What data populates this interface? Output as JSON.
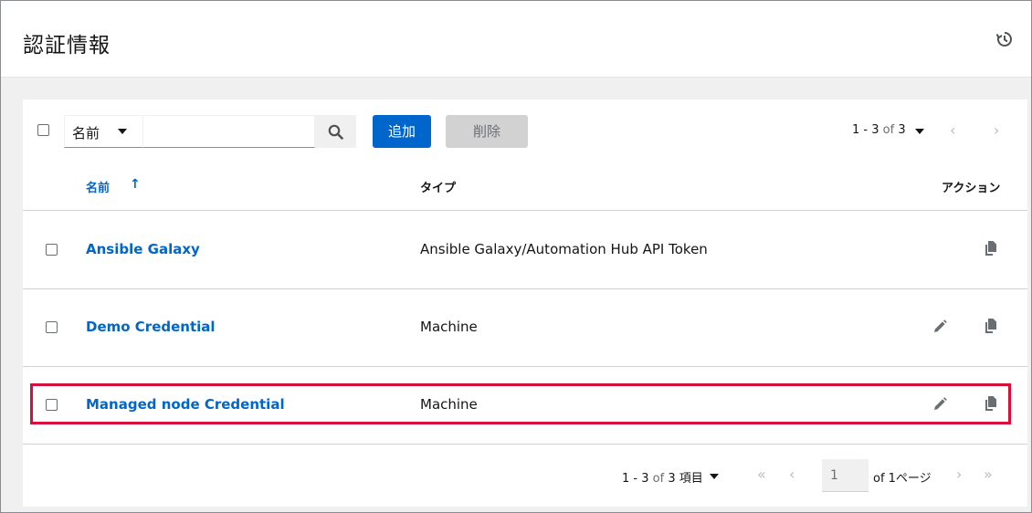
{
  "header": {
    "title": "認証情報",
    "history_icon": "history-icon"
  },
  "toolbar": {
    "filter_label": "名前",
    "search_value": "",
    "add_label": "追加",
    "delete_label": "削除",
    "pager_range": "1 - 3",
    "pager_of": "of",
    "pager_total": "3"
  },
  "table": {
    "columns": {
      "name": "名前",
      "sort_arrow": "↑",
      "type": "タイプ",
      "actions": "アクション"
    },
    "rows": [
      {
        "name": "Ansible Galaxy",
        "type": "Ansible Galaxy/Automation Hub API Token",
        "editable": false
      },
      {
        "name": "Demo Credential",
        "type": "Machine",
        "editable": true
      },
      {
        "name": "Managed node Credential",
        "type": "Machine",
        "editable": true
      }
    ]
  },
  "pagination": {
    "range": "1 - 3",
    "of": "of",
    "total": "3",
    "unit": "項目",
    "page": "1",
    "of_pages": "of 1ページ"
  },
  "colors": {
    "accent": "#0066cc",
    "highlight": "#d6103a"
  }
}
